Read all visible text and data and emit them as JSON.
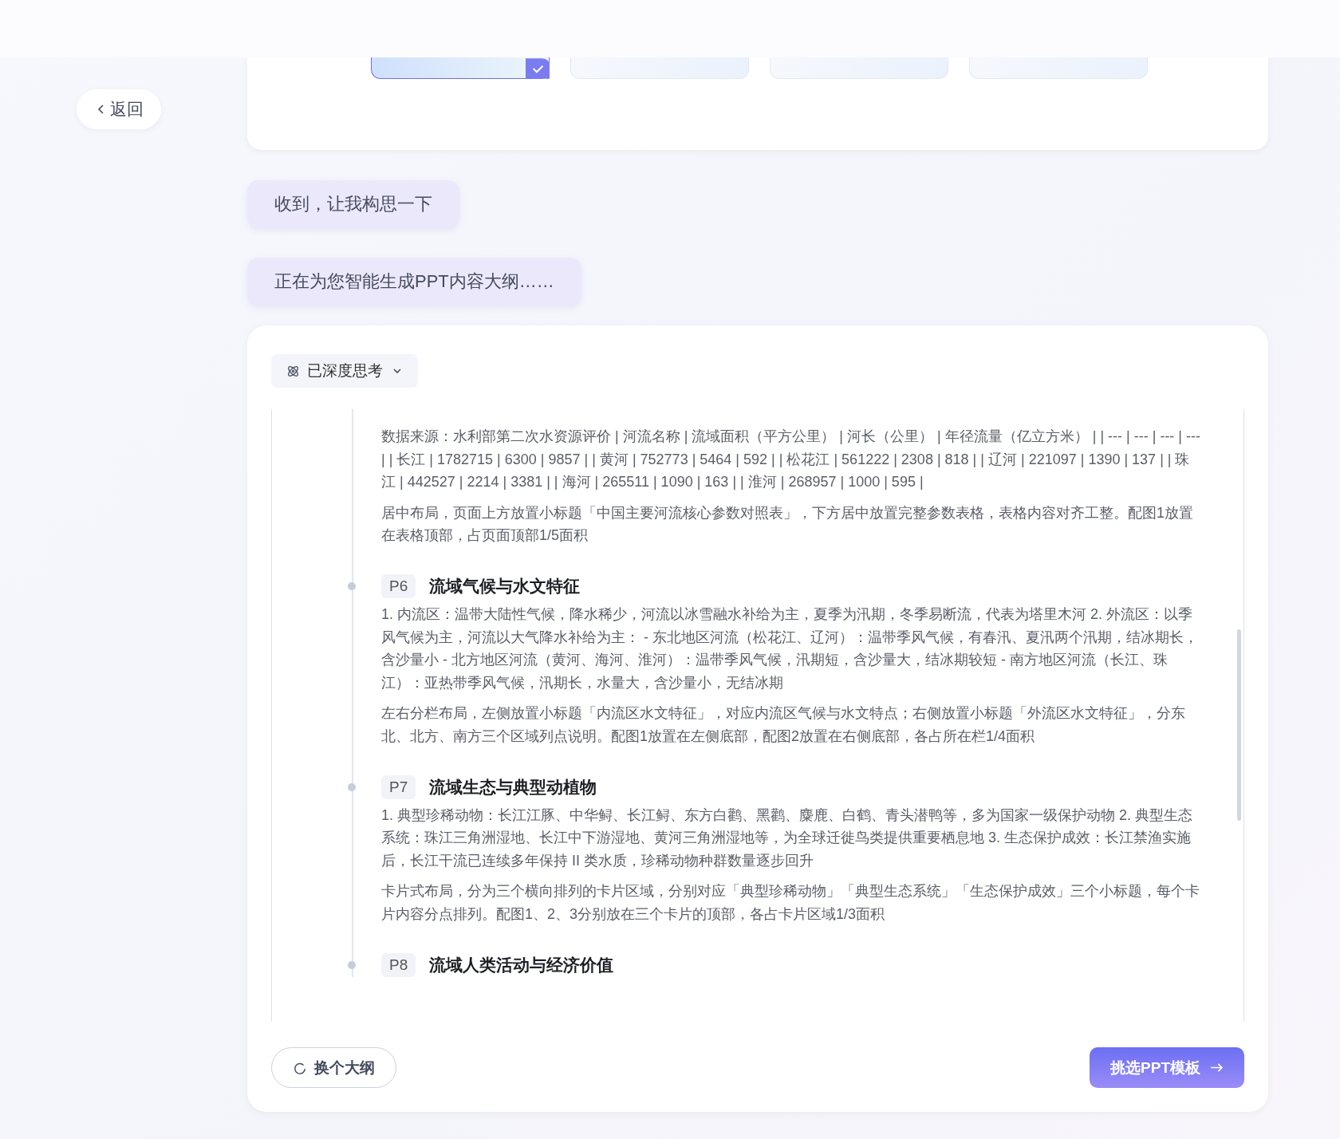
{
  "back_button": {
    "label": "返回"
  },
  "templates": [
    {
      "selected": true
    },
    {
      "selected": false
    },
    {
      "selected": false
    },
    {
      "selected": false
    }
  ],
  "messages": [
    "收到，让我构思一下",
    "正在为您智能生成PPT内容大纲……"
  ],
  "thinking": {
    "label": "已深度思考"
  },
  "outline": [
    {
      "paragraphs": [
        "数据来源：水利部第二次水资源评价 | 河流名称 | 流域面积（平方公里） | 河长（公里） | 年径流量（亿立方米） | | --- | --- | --- | --- | | 长江 | 1782715 | 6300 | 9857 | | 黄河 | 752773 | 5464 | 592 | | 松花江 | 561222 | 2308 | 818 | | 辽河 | 221097 | 1390 | 137 | | 珠江 | 442527 | 2214 | 3381 | | 海河 | 265511 | 1090 | 163 | | 淮河 | 268957 | 1000 | 595 |",
        "居中布局，页面上方放置小标题「中国主要河流核心参数对照表」，下方居中放置完整参数表格，表格内容对齐工整。配图1放置在表格顶部，占页面顶部1/5面积"
      ]
    },
    {
      "page": "P6",
      "title": "流域气候与水文特征",
      "paragraphs": [
        "1. 内流区：温带大陆性气候，降水稀少，河流以冰雪融水补给为主，夏季为汛期，冬季易断流，代表为塔里木河 2. 外流区：以季风气候为主，河流以大气降水补给为主： - 东北地区河流（松花江、辽河）：温带季风气候，有春汛、夏汛两个汛期，结冰期长，含沙量小 - 北方地区河流（黄河、海河、淮河）：温带季风气候，汛期短，含沙量大，结冰期较短 - 南方地区河流（长江、珠江）：亚热带季风气候，汛期长，水量大，含沙量小，无结冰期",
        "左右分栏布局，左侧放置小标题「内流区水文特征」，对应内流区气候与水文特点；右侧放置小标题「外流区水文特征」，分东北、北方、南方三个区域列点说明。配图1放置在左侧底部，配图2放置在右侧底部，各占所在栏1/4面积"
      ]
    },
    {
      "page": "P7",
      "title": "流域生态与典型动植物",
      "paragraphs": [
        "1. 典型珍稀动物：长江江豚、中华鲟、长江鲟、东方白鹳、黑鹳、麋鹿、白鹤、青头潜鸭等，多为国家一级保护动物 2. 典型生态系统：珠江三角洲湿地、长江中下游湿地、黄河三角洲湿地等，为全球迁徙鸟类提供重要栖息地 3. 生态保护成效：长江禁渔实施后，长江干流已连续多年保持 II 类水质，珍稀动物种群数量逐步回升",
        "卡片式布局，分为三个横向排列的卡片区域，分别对应「典型珍稀动物」「典型生态系统」「生态保护成效」三个小标题，每个卡片内容分点排列。配图1、2、3分别放在三个卡片的顶部，各占卡片区域1/3面积"
      ]
    },
    {
      "page": "P8",
      "title": "流域人类活动与经济价值"
    }
  ],
  "buttons": {
    "regenerate": "换个大纲",
    "next": "挑选PPT模板"
  }
}
